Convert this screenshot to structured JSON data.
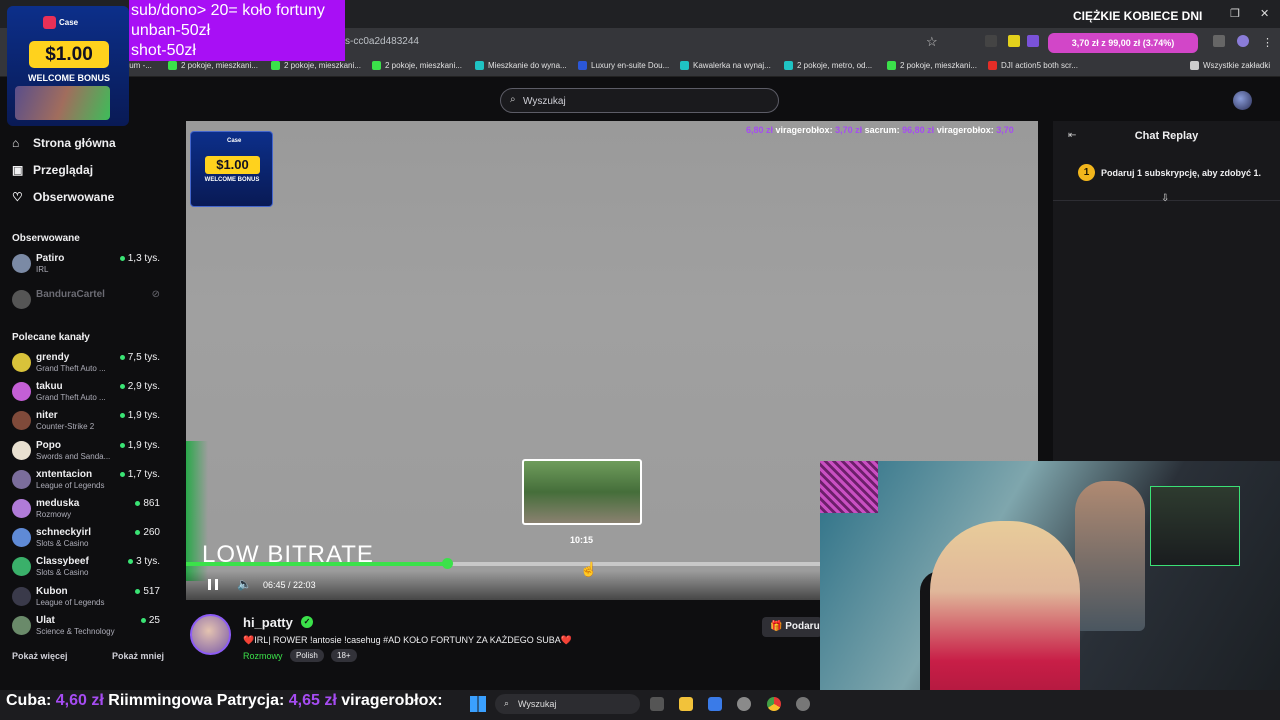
{
  "window": {
    "title": "CIĘŻKIE KOBIECE DNI",
    "url": "s-cc0a2d483244"
  },
  "bookmarks": [
    {
      "label": "nium -...",
      "color": "#888888"
    },
    {
      "label": "2 pokoje, mieszkani...",
      "color": "#3be14a"
    },
    {
      "label": "2 pokoje, mieszkani...",
      "color": "#3be14a"
    },
    {
      "label": "2 pokoje, mieszkani...",
      "color": "#3be14a"
    },
    {
      "label": "Mieszkanie do wyna...",
      "color": "#1fc3c3"
    },
    {
      "label": "Luxury en-suite Dou...",
      "color": "#2b57d8"
    },
    {
      "label": "Kawalerka na wynaj...",
      "color": "#1fc3c3"
    },
    {
      "label": "2 pokoje, metro, od...",
      "color": "#1fc3c3"
    },
    {
      "label": "2 pokoje, mieszkani...",
      "color": "#3be14a"
    },
    {
      "label": "DJI action5 both scr...",
      "color": "#e52d27"
    },
    {
      "label": "Wszystkie zakładki",
      "color": "#cccccc"
    }
  ],
  "donate_widget": "3,70 zł z 99,00 zł (3.74%)",
  "overlay": {
    "promo_amount": "$1.00",
    "promo_bonus": "WELCOME BONUS",
    "promo_brand": "Case",
    "alerts": [
      "sub/dono> 20= koło fortuny",
      "unban-50zł",
      "shot-50zł"
    ]
  },
  "nav": [
    {
      "label": "Strona główna",
      "icon": "home-icon",
      "glyph": "⌂"
    },
    {
      "label": "Przeglądaj",
      "icon": "browse-icon",
      "glyph": "▣"
    },
    {
      "label": "Obserwowane",
      "icon": "heart-icon",
      "glyph": "♡"
    }
  ],
  "followed_title": "Obserwowane",
  "followed": [
    {
      "name": "Patiro",
      "category": "IRL",
      "viewers": "1,3 tys.",
      "color": "#7b8aa5",
      "live": true
    },
    {
      "name": "BanduraCartel",
      "category": "",
      "viewers": "",
      "color": "#555555",
      "live": false
    }
  ],
  "recommended_title": "Polecane kanały",
  "recommended": [
    {
      "name": "grendy",
      "category": "Grand Theft Auto ...",
      "viewers": "7,5 tys.",
      "color": "#d8c23a"
    },
    {
      "name": "takuu",
      "category": "Grand Theft Auto ...",
      "viewers": "2,9 tys.",
      "color": "#c45fd6"
    },
    {
      "name": "niter",
      "category": "Counter-Strike 2",
      "viewers": "1,9 tys.",
      "color": "#7f4a3a"
    },
    {
      "name": "Popo",
      "category": "Swords and Sanda...",
      "viewers": "1,9 tys.",
      "color": "#e8e0d0"
    },
    {
      "name": "xntentacion",
      "category": "League of Legends",
      "viewers": "1,7 tys.",
      "color": "#7b6d9c"
    },
    {
      "name": "meduska",
      "category": "Rozmowy",
      "viewers": "861",
      "color": "#b07bd8"
    },
    {
      "name": "schneckyirl",
      "category": "Slots & Casino",
      "viewers": "260",
      "color": "#5f8ad6"
    },
    {
      "name": "Classybeef",
      "category": "Slots & Casino",
      "viewers": "3 tys.",
      "color": "#3ab06a"
    },
    {
      "name": "Kubon",
      "category": "League of Legends",
      "viewers": "517",
      "color": "#3a3a4a"
    },
    {
      "name": "Ulat",
      "category": "Science & Technology",
      "viewers": "25",
      "color": "#6a8a6a"
    }
  ],
  "show_more": "Pokaż więcej",
  "show_less": "Pokaż mniej",
  "search": {
    "placeholder": "Wyszukaj"
  },
  "player": {
    "ticker": [
      {
        "amount": "6,80 zł",
        "name": "viragerobłox:"
      },
      {
        "amount": "3,70 zł",
        "name": "sacrum:"
      },
      {
        "amount": "96,80 zł",
        "name": "viragerobłox:"
      },
      {
        "amount": "3,70",
        "name": ""
      }
    ],
    "low_bitrate": "LOW BITRATE",
    "preview_time": "10:15",
    "current_time": "06:45",
    "duration": "22:03",
    "progress": 0.306
  },
  "chat": {
    "title": "Chat Replay",
    "gift_badge": "1",
    "gift_text": "Podaruj 1 subskrypcję, aby zdobyć 1."
  },
  "stream": {
    "streamer": "hi_patty",
    "title": "❤️IRL| ROWER !antosie !casehug #AD  KOŁO FORTUNY ZA KAŻDEGO SUBA❤️",
    "category": "Rozmowy",
    "tags": [
      "Polish",
      "18+"
    ],
    "gift_button": "Podaru"
  },
  "taskbar": {
    "ticker_prefix": "Cuba:",
    "ticker_amount_1": "4,60 zł",
    "ticker_name": "Riimmingowa Patrycja:",
    "ticker_amount_2": "4,65 zł",
    "ticker_name_2": "viragerobłox:",
    "search_placeholder": "Wyszukaj"
  }
}
